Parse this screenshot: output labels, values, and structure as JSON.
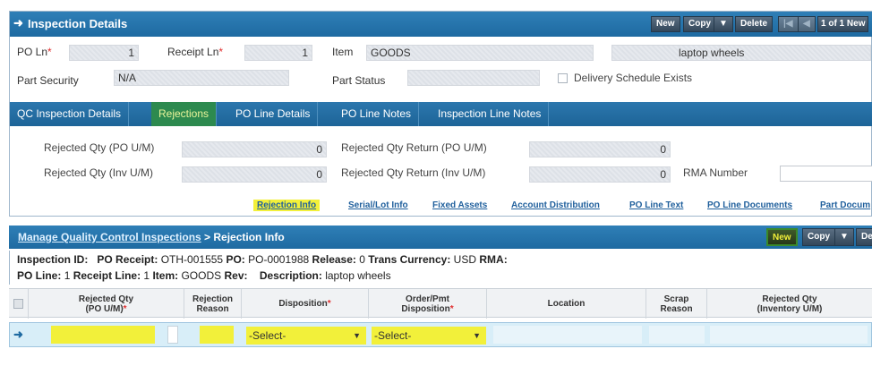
{
  "top": {
    "title": "Inspection Details",
    "toolbar": {
      "new": "New",
      "copy": "Copy",
      "dropdown": "▼",
      "delete": "Delete",
      "first": "|◀",
      "prev": "◀",
      "page": "1 of 1",
      "new2": "New"
    },
    "fields": {
      "po_ln_label": "PO Ln",
      "po_ln_value": "1",
      "receipt_ln_label": "Receipt Ln",
      "receipt_ln_value": "1",
      "item_label": "Item",
      "item_value": "GOODS",
      "item_desc": "laptop wheels",
      "part_security_label": "Part Security",
      "part_security_value": "N/A",
      "part_status_label": "Part Status",
      "delivery_label": "Delivery Schedule Exists"
    },
    "tabs": [
      "QC Inspection Details",
      "Rejections",
      "PO Line Details",
      "PO Line Notes",
      "Inspection Line Notes"
    ],
    "rejections": {
      "rej_qty_po_label": "Rejected Qty (PO U/M)",
      "rej_qty_po_value": "0",
      "rej_qty_inv_label": "Rejected Qty (Inv U/M)",
      "rej_qty_inv_value": "0",
      "rej_ret_po_label": "Rejected Qty Return (PO U/M)",
      "rej_ret_po_value": "0",
      "rej_ret_inv_label": "Rejected Qty Return (Inv U/M)",
      "rej_ret_inv_value": "0",
      "rma_label": "RMA Number"
    },
    "sublinks": [
      "Rejection Info",
      "Serial/Lot Info",
      "Fixed Assets",
      "Account Distribution",
      "PO Line Text",
      "PO Line Documents",
      "Part Docum"
    ]
  },
  "bottom": {
    "breadcrumb_link": "Manage Quality Control Inspections",
    "breadcrumb_current": " > Rejection Info",
    "toolbar": {
      "new": "New",
      "copy": "Copy",
      "dropdown": "▼",
      "more": "De"
    },
    "info": {
      "inspection_id_label": "Inspection ID:",
      "po_receipt_label": "PO Receipt:",
      "po_receipt_value": "OTH-001555",
      "po_label": "PO:",
      "po_value": "PO-0001988",
      "release_label": "Release:",
      "release_value": "0",
      "currency_label": "Trans Currency:",
      "currency_value": "USD",
      "rma_label": "RMA:",
      "po_line_label": "PO Line:",
      "po_line_value": "1",
      "receipt_line_label": "Receipt Line:",
      "receipt_line_value": "1",
      "item_label": "Item:",
      "item_value": "GOODS",
      "rev_label": "Rev:",
      "desc_label": "Description:",
      "desc_value": "laptop wheels"
    },
    "columns": {
      "rej_qty_po_1": "Rejected Qty",
      "rej_qty_po_2": "(PO U/M)",
      "reason_1": "Rejection",
      "reason_2": "Reason",
      "disposition": "Disposition",
      "order_1": "Order/Pmt",
      "order_2": "Disposition",
      "location": "Location",
      "scrap_1": "Scrap",
      "scrap_2": "Reason",
      "rej_inv_1": "Rejected Qty",
      "rej_inv_2": "(Inventory U/M)"
    },
    "row": {
      "disposition_select": "-Select-",
      "order_select": "-Select-"
    }
  },
  "colors": {
    "header_blue": "#1e6aa1",
    "highlight": "#f2f03a",
    "active_tab": "#2d8a4f",
    "required": "#e03030"
  }
}
